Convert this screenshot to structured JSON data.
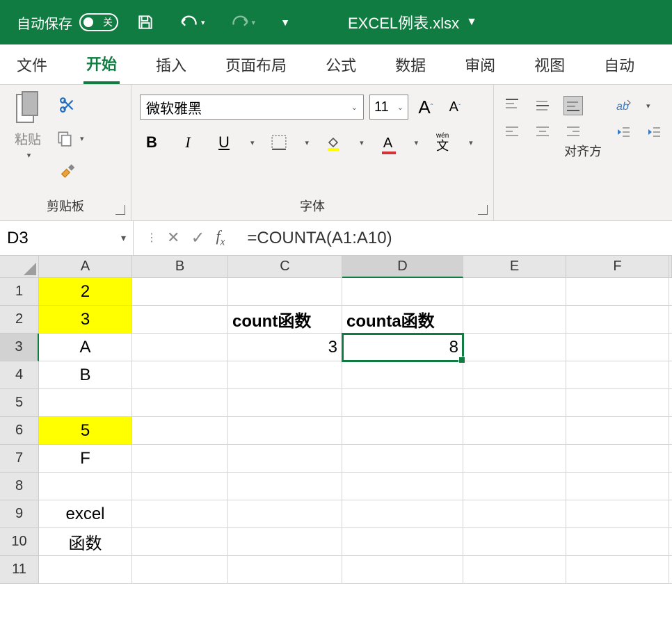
{
  "titlebar": {
    "autosave_label": "自动保存",
    "toggle_state": "关",
    "filename": "EXCEL例表.xlsx"
  },
  "tabs": {
    "file": "文件",
    "home": "开始",
    "insert": "插入",
    "pagelayout": "页面布局",
    "formulas": "公式",
    "data": "数据",
    "review": "审阅",
    "view": "视图",
    "auto": "自动"
  },
  "ribbon": {
    "clipboard_label": "剪贴板",
    "paste_label": "粘贴",
    "font_label": "字体",
    "align_label": "对齐方",
    "font_name": "微软雅黑",
    "font_size": "11",
    "wen_label": "wén",
    "wen_char": "文"
  },
  "namebox": {
    "value": "D3"
  },
  "formula": {
    "value": "=COUNTA(A1:A10)"
  },
  "cols": [
    "A",
    "B",
    "C",
    "D",
    "E",
    "F"
  ],
  "rows": [
    "1",
    "2",
    "3",
    "4",
    "5",
    "6",
    "7",
    "8",
    "9",
    "10",
    "11"
  ],
  "cells": {
    "A1": "2",
    "A2": "3",
    "A3": "A",
    "A4": "B",
    "A6": "5",
    "A7": "F",
    "A9": "excel",
    "A10": "函数",
    "C2": "count函数",
    "D2": "counta函数",
    "C3": "3",
    "D3": "8"
  },
  "selected": {
    "col": "D",
    "row": "3"
  }
}
